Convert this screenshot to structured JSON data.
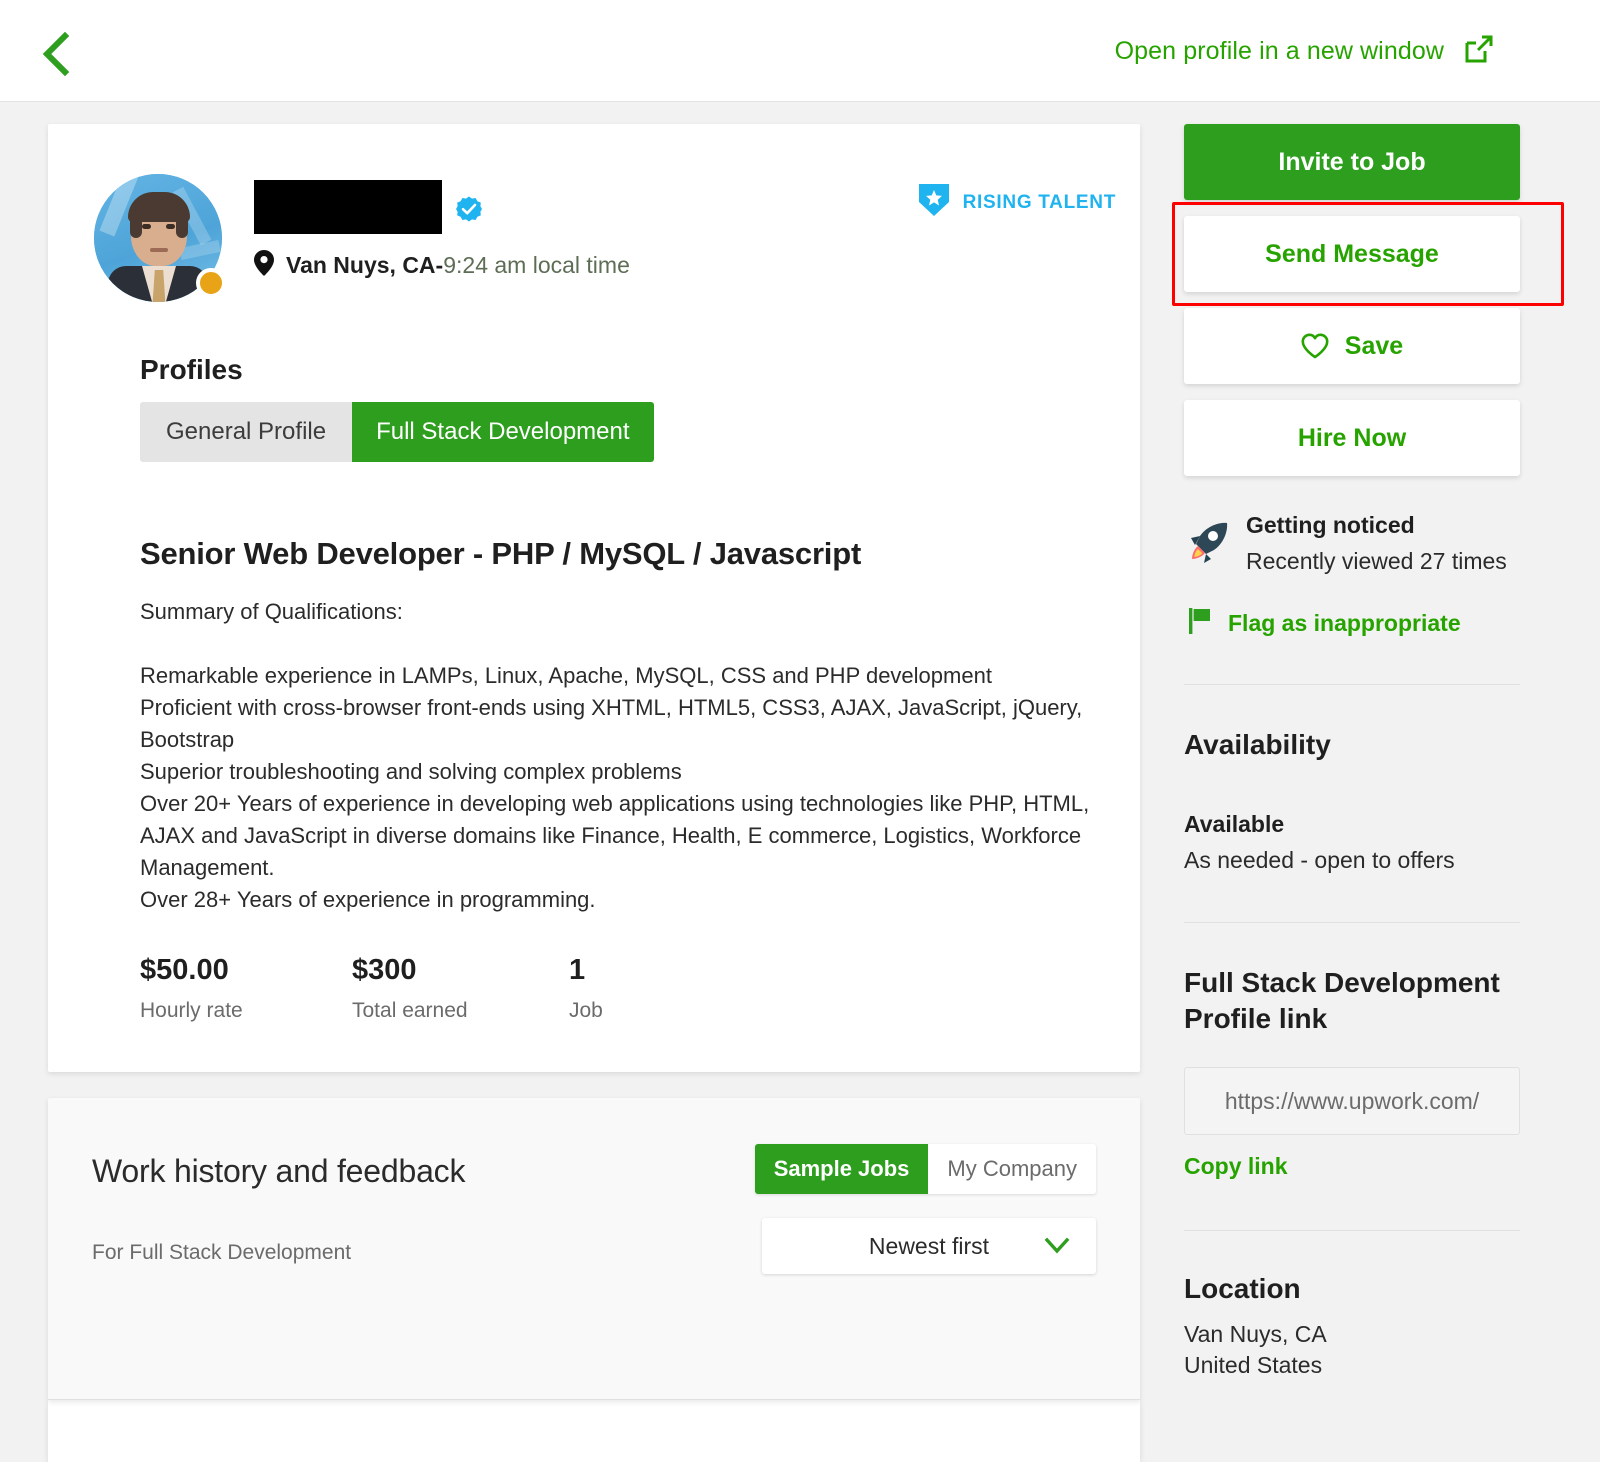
{
  "topbar": {
    "back_icon": "chevron-left-icon",
    "open_profile_label": "Open profile in a new window",
    "open_profile_icon": "external-link-icon"
  },
  "profile": {
    "name_redacted": "",
    "verified_icon": "verified-check-icon",
    "location_icon": "map-pin-icon",
    "location_city": "Van Nuys, CA",
    "location_separator": " - ",
    "local_time": "9:24 am local time",
    "badge": {
      "icon": "rising-talent-shield-icon",
      "label": "RISING TALENT"
    },
    "avatar_status": "away",
    "profiles_heading": "Profiles",
    "profile_tabs": [
      {
        "label": "General Profile",
        "active": false
      },
      {
        "label": "Full Stack Development",
        "active": true
      }
    ],
    "job_title": "Senior Web Developer - PHP / MySQL / Javascript",
    "overview": "Summary of Qualifications:\n\nRemarkable experience in LAMPs, Linux, Apache, MySQL, CSS and PHP development\nProficient with cross-browser front-ends using XHTML, HTML5, CSS3, AJAX, JavaScript, jQuery, Bootstrap\nSuperior troubleshooting and solving complex problems\nOver 20+ Years of experience in developing web applications using technologies like PHP, HTML, AJAX and JavaScript in diverse domains like Finance, Health, E commerce, Logistics, Workforce Management.\nOver 28+ Years of experience in programming.",
    "stats": [
      {
        "value": "$50.00",
        "label": "Hourly rate"
      },
      {
        "value": "$300",
        "label": "Total earned"
      },
      {
        "value": "1",
        "label": "Job"
      }
    ]
  },
  "work_history": {
    "title": "Work history and feedback",
    "subtitle": "For Full Stack Development",
    "segments": [
      {
        "label": "Sample Jobs",
        "active": true
      },
      {
        "label": "My Company",
        "active": false
      }
    ],
    "sort": {
      "value": "Newest first",
      "icon": "chevron-down-icon"
    }
  },
  "sidebar": {
    "invite_label": "Invite to Job",
    "send_message_label": "Send Message",
    "save_label": "Save",
    "save_icon": "heart-icon",
    "hire_label": "Hire Now",
    "noticed": {
      "icon": "rocket-icon",
      "title": "Getting noticed",
      "detail": "Recently viewed 27 times"
    },
    "flag": {
      "icon": "flag-icon",
      "label": "Flag as inappropriate"
    },
    "availability": {
      "heading": "Availability",
      "status": "Available",
      "detail": "As needed - open to offers"
    },
    "profile_link": {
      "heading": "Full Stack Development Profile link",
      "url": "https://www.upwork.com/",
      "copy_label": "Copy link"
    },
    "location": {
      "heading": "Location",
      "city": "Van Nuys, CA",
      "country": "United States"
    }
  },
  "colors": {
    "brand_green": "#2e9e1f",
    "link_green": "#27a300",
    "badge_blue": "#1fb3f0",
    "highlight_red": "#ff0000",
    "status_orange": "#e8a317"
  }
}
